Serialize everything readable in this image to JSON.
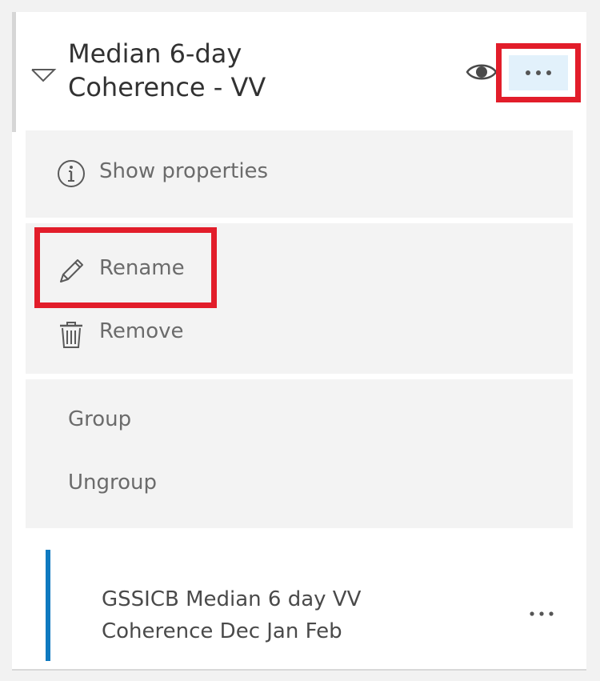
{
  "layer": {
    "title": "Median 6-day\nCoherence - VV",
    "expand_icon": "chevron-down-icon",
    "visibility_icon": "eye-icon",
    "more_icon": "more-horizontal-icon"
  },
  "menu": {
    "sections": [
      {
        "items": [
          {
            "label": "Show properties",
            "icon": "info-circle-icon"
          }
        ]
      },
      {
        "items": [
          {
            "label": "Rename",
            "icon": "pencil-icon"
          },
          {
            "label": "Remove",
            "icon": "trash-icon"
          }
        ]
      },
      {
        "items": [
          {
            "label": "Group"
          },
          {
            "label": "Ungroup"
          }
        ]
      }
    ]
  },
  "sublayer": {
    "title": "GSSICB Median 6 day VV\nCoherence Dec Jan Feb",
    "more_icon": "more-horizontal-icon"
  },
  "colors": {
    "highlight": "#e21d2a",
    "accent_bar": "#0f7ac0",
    "menu_background": "#f3f3f3",
    "more_button_background": "#e2f1fb"
  }
}
